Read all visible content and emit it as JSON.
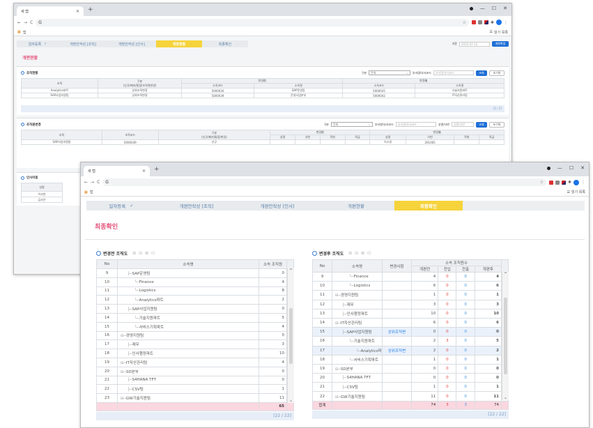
{
  "back": {
    "tab_title": "새 탭",
    "omni_text": "G",
    "bookmark_label": "앱",
    "reading_list": "읽기 목록",
    "steps": [
      "일자등록",
      "개편안작성 [조직]",
      "개편안작성 [인사]",
      "개편현황",
      "최종확인"
    ],
    "date_label": "기준",
    "date_value": "2020-07-22",
    "main_button": "개편확정",
    "page_title": "개편현황",
    "org": {
      "title": "조직현황",
      "filter_label": "구분",
      "filter_value": "전체",
      "search_label": "부서명/부서코드",
      "search_ph": "부서명/부서코드",
      "btn_search": "조회",
      "btn_reset": "초기화",
      "h_org": "조직",
      "h_type": "구분",
      "h_type2": "(신규/폐지/통합/조직명변경)",
      "h_before": "변경前",
      "h_after": "변경後",
      "h_bcode": "소속코드",
      "h_bname": "소속명",
      "h_acode": "소속코드",
      "h_aname": "소속명",
      "rows": [
        [
          "Analytics파트",
          "상위조직변경",
          "5000030",
          "SAP운영팀",
          "5000035",
          "기술지원파트"
        ],
        [
          "SAP사업지원팀",
          "상위조직변경",
          "5000039",
          "운영사업본부",
          "5000042",
          "IT자산관리팀"
        ]
      ],
      "count": "[2 / 2]"
    },
    "hr": {
      "title": "조직원변경",
      "filter_label": "구분",
      "filter_value": "전체",
      "search_label": "부서명/부서코드",
      "search_ph": "부서명/부서코드",
      "name_label": "성명/사번",
      "name_ph": "성명/사번",
      "btn_search": "조회",
      "btn_reset": "초기화",
      "h_org": "조직",
      "h_code": "조직코드",
      "h_type": "구분",
      "h_type2": "(신규/폐지/통합/변경)",
      "h_before": "변경前",
      "h_after": "변경後",
      "subs": [
        "성명",
        "사번",
        "직위",
        "직급",
        "성명",
        "사번",
        "직위",
        "직급"
      ],
      "row": [
        "SAP사업지원팀",
        "5000039",
        "신규",
        "",
        "",
        "",
        "",
        "이소영",
        "201005",
        "",
        ""
      ]
    },
    "emp": {
      "title": "인사이동",
      "h_name": "성명",
      "names": [
        "이서연",
        "김사은"
      ]
    }
  },
  "front": {
    "tab_title": "새 탭",
    "omni_text": "G",
    "bookmark_label": "앱",
    "reading_list": "읽기 목록",
    "steps": [
      "일자등록",
      "개편안작성 [조직]",
      "개편안작성 [인사]",
      "개편현황",
      "최종확인"
    ],
    "page_title": "최종확인",
    "left": {
      "title": "변경전 조직도",
      "h_no": "No",
      "h_name": "소속명",
      "h_count": "소속 조직원",
      "rows": [
        [
          "9",
          "SAP운영팀",
          "0",
          1
        ],
        [
          "10",
          "Finance",
          "4",
          2
        ],
        [
          "11",
          "Logistics",
          "8",
          2
        ],
        [
          "12",
          "Analytics파트",
          "2",
          2
        ],
        [
          "13",
          "SAP사업지원팀",
          "0",
          1
        ],
        [
          "14",
          "기술지원파트",
          "5",
          2
        ],
        [
          "15",
          "서비스기획파트",
          "4",
          2
        ],
        [
          "16",
          "경영지원팀",
          "0",
          0
        ],
        [
          "17",
          "재무",
          "3",
          1
        ],
        [
          "18",
          "인사행정파트",
          "10",
          1
        ],
        [
          "19",
          "IT자산관리팀",
          "4",
          0
        ],
        [
          "20",
          "SD본부",
          "0",
          0
        ],
        [
          "21",
          "S4HANA TFT",
          "0",
          1
        ],
        [
          "22",
          "CSV팀",
          "1",
          1
        ],
        [
          "23",
          "GW기술지원팀",
          "11",
          0
        ]
      ],
      "total": "65",
      "count": "[22 / 22]"
    },
    "right": {
      "title": "변경후 조직도",
      "h_no": "No",
      "h_name": "소속명",
      "h_change": "변경사항",
      "h_group": "소속 조직원수",
      "h_sub": [
        "개편전",
        "전입",
        "전출",
        "개편후"
      ],
      "rows": [
        [
          "9",
          "Finance",
          "",
          4,
          0,
          0,
          4,
          2
        ],
        [
          "10",
          "Logistics",
          "",
          6,
          0,
          0,
          6,
          2
        ],
        [
          "11",
          "경영지원팀",
          "",
          1,
          0,
          0,
          1,
          0
        ],
        [
          "12",
          "재무",
          "",
          3,
          0,
          0,
          3,
          1
        ],
        [
          "13",
          "인사행정파트",
          "",
          10,
          0,
          0,
          10,
          1
        ],
        [
          "14",
          "IT자산관리팀",
          "",
          6,
          0,
          0,
          6,
          0
        ],
        [
          "15",
          "SAP사업지원팀",
          "상위조직변",
          "0",
          0,
          0,
          0,
          1
        ],
        [
          "16",
          "기술지원파트",
          "",
          2,
          3,
          0,
          5,
          2
        ],
        [
          "17",
          "Analytics파",
          "상위조직변",
          "2",
          0,
          0,
          2,
          3
        ],
        [
          "18",
          "서비스기획파트",
          "",
          1,
          0,
          0,
          1,
          2
        ],
        [
          "19",
          "SD본부",
          "",
          0,
          0,
          0,
          0,
          0
        ],
        [
          "20",
          "S4HANA TFT",
          "",
          0,
          0,
          0,
          0,
          1
        ],
        [
          "21",
          "CSV팀",
          "",
          1,
          0,
          0,
          1,
          1
        ],
        [
          "22",
          "GW기술지원팀",
          "",
          11,
          0,
          0,
          11,
          0
        ]
      ],
      "total_label": "합계",
      "totals": [
        "74",
        "3",
        "3",
        "74"
      ],
      "count": "[22 / 22]"
    }
  }
}
